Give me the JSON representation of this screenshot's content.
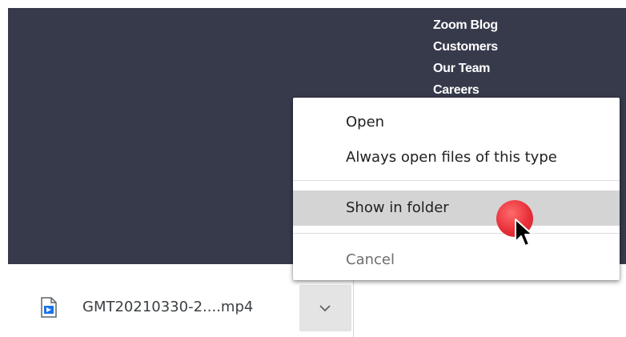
{
  "background_links": [
    "Zoom Blog",
    "Customers",
    "Our Team",
    "Careers"
  ],
  "context_menu": {
    "open": "Open",
    "always_open": "Always open files of this type",
    "show_in_folder": "Show in folder",
    "cancel": "Cancel"
  },
  "download_item": {
    "file_name": "GMT20210330-2....mp4",
    "icon": "video-file-icon",
    "menu_icon": "chevron-down-icon"
  },
  "colors": {
    "page_background": "#373a4b",
    "highlight": "#d4d4d4",
    "click_indicator": "#e8303a"
  }
}
